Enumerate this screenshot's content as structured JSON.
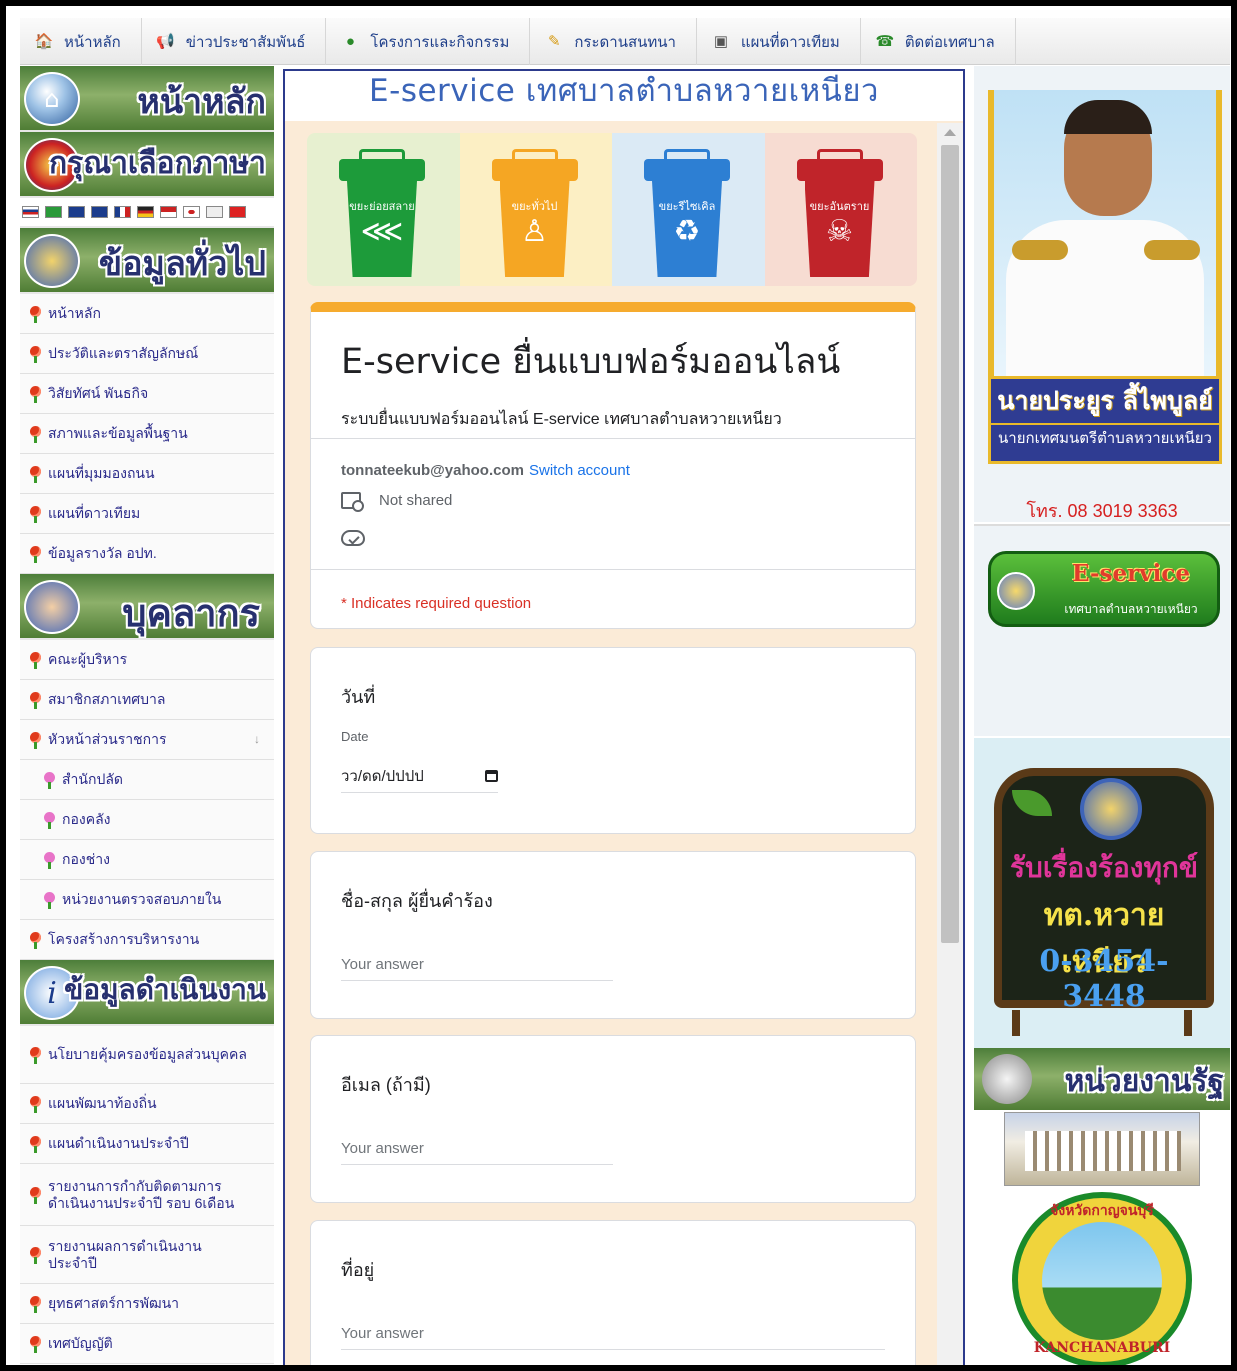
{
  "nav": {
    "items": [
      {
        "label": "หน้าหลัก",
        "icon": "home-icon"
      },
      {
        "label": "ข่าวประชาสัมพันธ์",
        "icon": "megaphone-icon"
      },
      {
        "label": "โครงการและกิจกรรม",
        "icon": "people-icon"
      },
      {
        "label": "กระดานสนทนา",
        "icon": "pencil-icon"
      },
      {
        "label": "แผนที่ดาวเทียม",
        "icon": "map-icon"
      },
      {
        "label": "ติดต่อเทศบาล",
        "icon": "phone-icon"
      }
    ]
  },
  "left": {
    "banner_home": "หน้าหลัก",
    "banner_lang": "กรุณาเลือกภาษา",
    "banner_general": "ข้อมูลทั่วไป",
    "general_items": [
      "หน้าหลัก",
      "ประวัติและตราสัญลักษณ์",
      "วิสัยทัศน์ พันธกิจ",
      "สภาพและข้อมูลพื้นฐาน",
      "แผนที่มุมมองถนน",
      "แผนที่ดาวเทียม",
      "ข้อมูลรางวัล อปท."
    ],
    "banner_staff": "บุคลากร",
    "staff_items": [
      "คณะผู้บริหาร",
      "สมาชิกสภาเทศบาล",
      "หัวหน้าส่วนราชการ"
    ],
    "staff_sub_items": [
      "สำนักปลัด",
      "กองคลัง",
      "กองช่าง",
      "หน่วยงานตรวจสอบภายใน"
    ],
    "staff_last": "โครงสร้างการบริหารงาน",
    "banner_ops": "ข้อมูลดำเนินงาน",
    "ops_items": [
      "นโยบายคุ้มครองข้อมูลส่วนบุคคล",
      "แผนพัฒนาท้องถิ่น",
      "แผนดำเนินงานประจำปี",
      "รายงานการกำกับติดตามการดำเนินงานประจำปี รอบ 6เดือน",
      "รายงานผลการดำเนินงานประจำปี",
      "ยุทธศาสตร์การพัฒนา",
      "เทศบัญญัติ"
    ]
  },
  "center": {
    "title": "E-service เทศบาลตำบลหวายเหนียว",
    "bins": [
      {
        "label": "ขยะย่อยสลาย",
        "color": "#1d9b3a",
        "bg": "#e7f0d0"
      },
      {
        "label": "ขยะทั่วไป",
        "color": "#f5a623",
        "bg": "#fcefc4"
      },
      {
        "label": "ขยะรีไซเคิล",
        "color": "#2d7fd3",
        "bg": "#dbeaf5"
      },
      {
        "label": "ขยะอันตราย",
        "color": "#c0242a",
        "bg": "#f7dcd2"
      }
    ],
    "form": {
      "heading": "E-service ยื่นแบบฟอร์มออนไลน์",
      "description": "ระบบยื่นแบบฟอร์มออนไลน์ E-service เทศบาลตำบลหวายเหนียว",
      "account_email": "tonnateekub@yahoo.com",
      "switch_account": "Switch account",
      "not_shared": "Not shared",
      "required_note": "* Indicates required question",
      "questions": [
        {
          "title": "วันที่",
          "sublabel": "Date",
          "value": "วว/ดด/ปปปป"
        },
        {
          "title": "ชื่อ-สกุล ผู้ยื่นคำร้อง",
          "placeholder": "Your answer"
        },
        {
          "title": "อีเมล (ถ้ามี)",
          "placeholder": "Your answer"
        },
        {
          "title": "ที่อยู่",
          "placeholder": "Your answer"
        }
      ]
    }
  },
  "right": {
    "mayor_name": "นายประยูร ลี้ไพบูลย์",
    "mayor_title": "นายกเทศมนตรีตำบลหวายเหนียว",
    "phone": "โทร. 08 3019 3363",
    "eservice_title": "E-service",
    "eservice_sub": "เทศบาลตำบลหวายเหนียว",
    "complaint_line1": "รับเรื่องร้องทุกข์",
    "complaint_line2": "ทต.หวายเหนียว",
    "complaint_phone": "0-3454-3448",
    "gov_banner": "หน่วยงานรัฐ",
    "kanchanaburi_th": "จังหวัดกาญจนบุรี",
    "kanchanaburi_en": "KANCHANABURI"
  }
}
